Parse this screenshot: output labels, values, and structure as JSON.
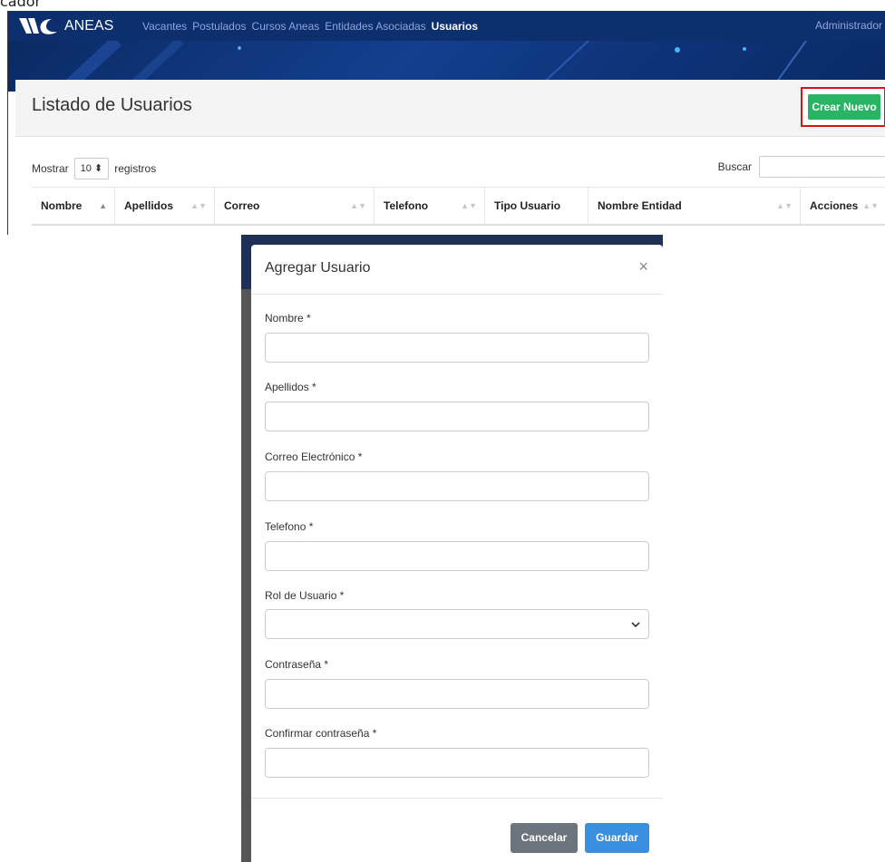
{
  "doc_snippet": "cador",
  "navbar": {
    "brand": "ANEAS",
    "links": [
      "Vacantes",
      "Postulados",
      "Cursos Aneas",
      "Entidades Asociadas",
      "Usuarios"
    ],
    "admin": "Administrador"
  },
  "list_page": {
    "title": "Listado de Usuarios",
    "create_button": "Crear Nuevo",
    "show_label": "Mostrar",
    "page_size": "10",
    "records_label": "registros",
    "search_label": "Buscar",
    "columns": [
      "Nombre",
      "Apellidos",
      "Correo",
      "Telefono",
      "Tipo Usuario",
      "Nombre Entidad",
      "Acciones"
    ]
  },
  "modal": {
    "title": "Agregar Usuario",
    "close": "×",
    "fields": [
      {
        "label": "Nombre *",
        "type": "text",
        "value": ""
      },
      {
        "label": "Apellidos *",
        "type": "text",
        "value": ""
      },
      {
        "label": "Correo Electrónico *",
        "type": "text",
        "value": ""
      },
      {
        "label": "Telefono *",
        "type": "text",
        "value": ""
      },
      {
        "label": "Rol de Usuario *",
        "type": "select",
        "value": ""
      },
      {
        "label": "Contraseña *",
        "type": "password",
        "value": ""
      },
      {
        "label": "Confirmar contraseña *",
        "type": "password",
        "value": ""
      }
    ],
    "cancel_button": "Cancelar",
    "save_button": "Guardar"
  },
  "colors": {
    "navbar": "#0d2f6e",
    "create_button": "#28b463",
    "highlight_border": "#e01010",
    "cancel_button": "#6c757d",
    "save_button": "#3b8fe0"
  }
}
